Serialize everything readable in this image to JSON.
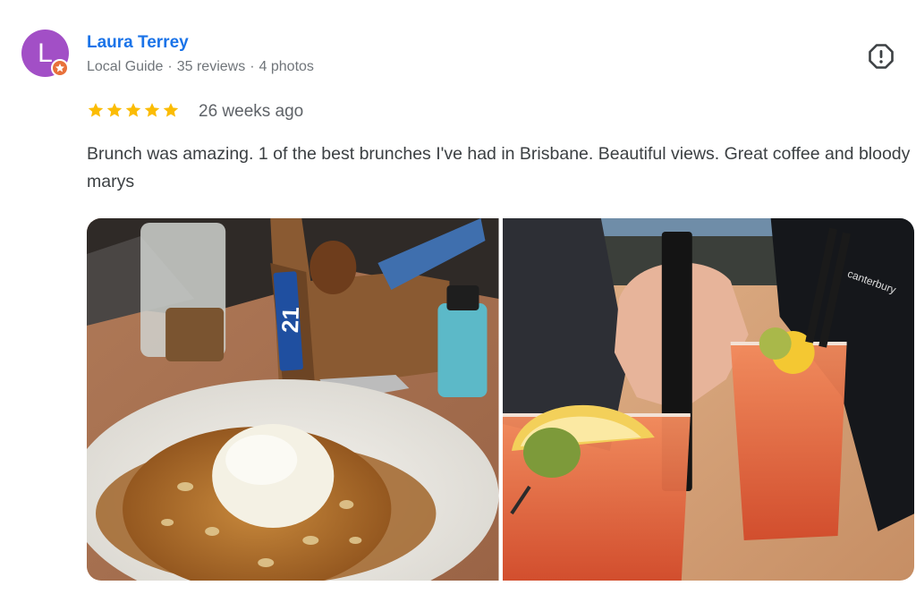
{
  "review": {
    "author": {
      "initial": "L",
      "name": "Laura Terrey",
      "avatar_color": "#a24fc6",
      "badge_color": "#e8703a",
      "meta_level": "Local Guide",
      "meta_reviews": "35 reviews",
      "meta_photos": "4 photos",
      "meta_separator": "·"
    },
    "rating": {
      "stars": 5,
      "max": 5,
      "star_color": "#fbbc04"
    },
    "time": "26 weeks ago",
    "text": "Brunch was amazing. 1 of the best brunches I've had in Brisbane. Beautiful views. Great coffee and bloody marys",
    "report_icon": "report-exclamation-icon",
    "photos": [
      {
        "subject": "waffle-with-ice-cream-photo",
        "table_number": "21"
      },
      {
        "subject": "bloody-mary-cocktails-photo",
        "shirt_logo": "canterbury"
      }
    ],
    "colors": {
      "name_link": "#1a73e8",
      "meta": "#70757a",
      "body_text": "#3c4043"
    }
  }
}
